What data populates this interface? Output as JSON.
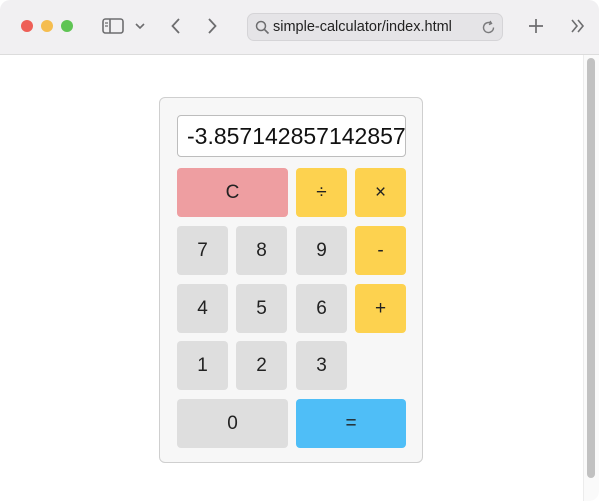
{
  "browser": {
    "url": "simple-calculator/index.html"
  },
  "calculator": {
    "display": "-3.857142857142857",
    "buttons": {
      "clear": "C",
      "divide": "÷",
      "multiply": "×",
      "seven": "7",
      "eight": "8",
      "nine": "9",
      "minus": "-",
      "four": "4",
      "five": "5",
      "six": "6",
      "plus": "+",
      "one": "1",
      "two": "2",
      "three": "3",
      "zero": "0",
      "equals": "="
    }
  },
  "colors": {
    "number_button": "#dedede",
    "operator_button": "#fdd24f",
    "clear_button": "#ee9ea1",
    "equals_button": "#4fbef7"
  }
}
